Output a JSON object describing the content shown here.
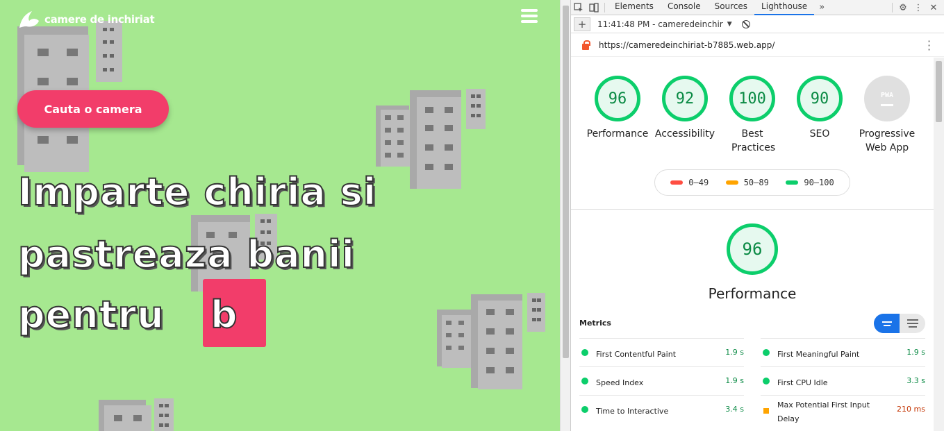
{
  "site": {
    "logo_text": "camere de inchiriat",
    "cta_label": "Cauta o camera",
    "hero_line1": "Imparte chiria si",
    "hero_line2": "pastreaza banii",
    "hero_line3": "pentru",
    "typed_text": "b",
    "colors": {
      "background": "#a6e890",
      "accent": "#f23d6a"
    }
  },
  "devtools": {
    "tabs": [
      "Elements",
      "Console",
      "Sources",
      "Lighthouse"
    ],
    "active_tab": "Lighthouse",
    "more_tabs_icon": "chevron-double-right-icon",
    "run_label": "11:41:48 PM - cameredeinchir",
    "url": "https://cameredeinchiriat-b7885.web.app/"
  },
  "report": {
    "scores": [
      {
        "label": "Performance",
        "value": "96"
      },
      {
        "label": "Accessibility",
        "value": "92"
      },
      {
        "label": "Best Practices",
        "value": "100"
      },
      {
        "label": "SEO",
        "value": "90"
      },
      {
        "label": "Progressive Web App",
        "value": "PWA"
      }
    ],
    "legend": [
      "0–49",
      "50–89",
      "90–100"
    ],
    "legend_colors": [
      "#ff4e42",
      "#ffa400",
      "#0cce6b"
    ],
    "performance_score": "96",
    "performance_title": "Performance",
    "metrics_heading": "Metrics",
    "metrics": [
      {
        "name": "First Contentful Paint",
        "value": "1.9 s",
        "status": "pass"
      },
      {
        "name": "First Meaningful Paint",
        "value": "1.9 s",
        "status": "pass"
      },
      {
        "name": "Speed Index",
        "value": "1.9 s",
        "status": "pass"
      },
      {
        "name": "First CPU Idle",
        "value": "3.3 s",
        "status": "pass"
      },
      {
        "name": "Time to Interactive",
        "value": "3.4 s",
        "status": "pass"
      },
      {
        "name": "Max Potential First Input Delay",
        "value": "210 ms",
        "status": "average"
      }
    ]
  }
}
